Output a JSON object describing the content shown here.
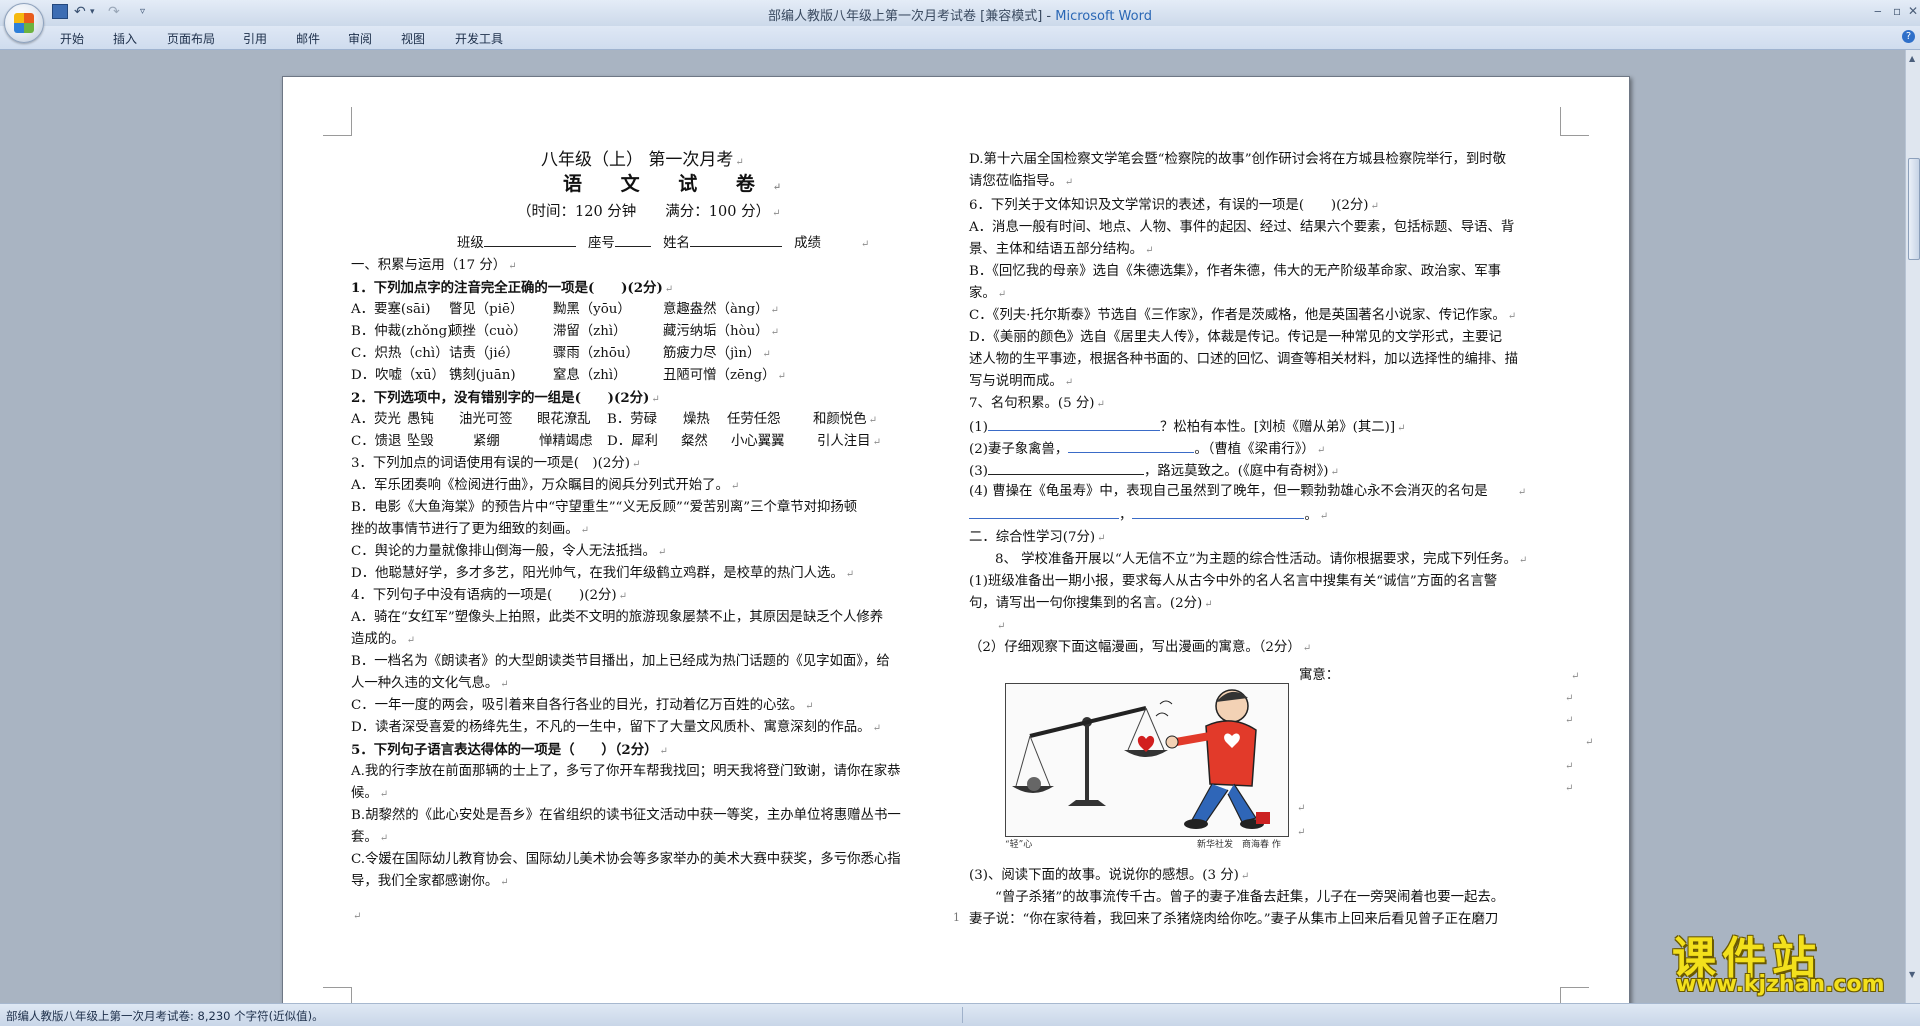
{
  "window": {
    "title": "部编人教版八年级上第一次月考试卷 [兼容模式] - ",
    "app_name": "Microsoft Word",
    "min_label": "‒",
    "max_label": "▫",
    "close_label": "✕"
  },
  "quick_access": {
    "undo_label": "↶",
    "redo_label": "↷",
    "drop_label": "▾",
    "custom_label": "▿"
  },
  "tabs": [
    "开始",
    "插入",
    "页面布局",
    "引用",
    "邮件",
    "审阅",
    "视图",
    "开发工具"
  ],
  "help_label": "?",
  "status_bar": {
    "text": "部编人教版八年级上第一次月考试卷: 8,230 个字符(近似值)。"
  },
  "page_number": "1",
  "left_column": {
    "title1": "八年级（上） 第一次月考",
    "title2": "语 文 试 卷",
    "time_line": "（时间：120 分钟　　满分：100 分）",
    "info_class": "班级",
    "info_seat": "座号",
    "info_name": "姓名",
    "info_score": "成绩",
    "sec1": "一、积累与运用（17 分）",
    "q1": "1．下列加点字的注音完全正确的一项是(　　)(2分)",
    "q1a": [
      "A．要塞(sāi)",
      "瞥见（piē）",
      "黝黑（yōu）",
      "意趣盎然（àng）"
    ],
    "q1b": [
      "B．仲裁(zhǒng)",
      "顿挫（cuò）",
      "滞留（zhì）",
      "藏污纳垢（hòu）"
    ],
    "q1c": [
      "C．炽热（chì）",
      "诘责（jié）",
      "骤雨（zhōu）",
      "筋疲力尽（jìn）"
    ],
    "q1d": [
      "D．吹嘘（xū）",
      "镌刻(juān)",
      "窒息（zhì）",
      "丑陋可憎（zēng）"
    ],
    "q2": "2．下列选项中，没有错别字的一组是(　　)(2分)",
    "q2ab": [
      "A．荧光",
      "愚钝",
      "油光可签",
      "眼花潦乱",
      "B．劳碌",
      "燥热",
      "任劳任怨",
      "和颜悦色"
    ],
    "q2cd": [
      "C．馈退",
      "坠毁",
      "紧绷",
      "惮精竭虑",
      "D．犀利",
      "粲然",
      "小心翼翼",
      "引人注目"
    ],
    "q3": "3．下列加点的词语使用有误的一项是(　)(2分)",
    "q3a": "A．军乐团奏响《检阅进行曲》，万众瞩目的阅兵分列式开始了。",
    "q3b1": "B．电影《大鱼海棠》的预告片中“守望重生”“义无反顾”“爱苦别离”三个章节对抑扬顿",
    "q3b2": "挫的故事情节进行了更为细致的刻画。",
    "q3c": "C．舆论的力量就像排山倒海一般，令人无法抵挡。",
    "q3d": "D．他聪慧好学，多才多艺，阳光帅气，在我们年级鹤立鸡群，是校草的热门人选。",
    "q4": "4．下列句子中没有语病的一项是(　　)(2分)",
    "q4a1": "A．骑在“女红军”塑像头上拍照，此类不文明的旅游现象屡禁不止，其原因是缺乏个人修养",
    "q4a2": "造成的。",
    "q4b1": "B．一档名为《朗读者》的大型朗读类节目播出，加上已经成为热门话题的《见字如面》，给",
    "q4b2": "人一种久违的文化气息。",
    "q4c": "C．一年一度的两会，吸引着来自各行各业的目光，打动着亿万百姓的心弦。",
    "q4d": "D．读者深受喜爱的杨绛先生，不凡的一生中，留下了大量文风质朴、寓意深刻的作品。",
    "q5": "5．下列句子语言表达得体的一项是（　　）（2分）",
    "q5a1": "A.我的行李放在前面那辆的士上了，多亏了你开车帮我找回；明天我将登门致谢，请你在家恭",
    "q5a2": "候。",
    "q5b1": "B.胡黎然的《此心安处是吾乡》在省组织的读书征文活动中获一等奖，主办单位将惠赠丛书一",
    "q5b2": "套。",
    "q5c1": "C.令媛在国际幼儿教育协会、国际幼儿美术协会等多家举办的美术大赛中获奖，多亏你悉心指",
    "q5c2": "导，我们全家都感谢你。"
  },
  "right_column": {
    "d1": "D.第十六届全国检察文学笔会暨“检察院的故事”创作研讨会将在方城县检察院举行，到时敬",
    "d2": "请您莅临指导。",
    "q6": "6．下列关于文体知识及文学常识的表述，有误的一项是(　　)(2分)",
    "q6a1": "A．消息一般有时间、地点、人物、事件的起因、经过、结果六个要素，包括标题、导语、背",
    "q6a2": "景、主体和结语五部分结构。",
    "q6b1": "B．《回忆我的母亲》选自《朱德选集》，作者朱德，伟大的无产阶级革命家、政治家、军事",
    "q6b2": "家。",
    "q6c": "C．《列夫·托尔斯泰》节选自《三作家》，作者是茨威格，他是英国著名小说家、传记作家。",
    "q6d1": "D．《美丽的颜色》选自《居里夫人传》，体裁是传记。传记是一种常见的文学形式，主要记",
    "q6d2": "述人物的生平事迹，根据各种书面的、口述的回忆、调查等相关材料，加以选择性的编排、描",
    "q6d3": "写与说明而成。",
    "q7": "7、名句积累。(5 分)",
    "q7_1_pre": "(1)",
    "q7_1_post": "？松柏有本性。[刘桢《赠从弟》(其二)]",
    "q7_2_pre": "(2)妻子象禽兽，",
    "q7_2_post": "。（曹植《梁甫行》）",
    "q7_3_pre": "(3)",
    "q7_3_post": "，路远莫致之。(《庭中有奇树》)",
    "q7_4": "(4) 曹操在《龟虽寿》中，表现自己虽然到了晚年，但一颗勃勃雄心永不会消灭的名句是",
    "q7_4b": "，",
    "q7_4c": "。",
    "sec2": "二．综合性学习(7分)",
    "q8": "8、 学校准备开展以“人无信不立”为主题的综合性活动。请你根据要求，完成下列任务。",
    "q8_1a": "(1)班级准备出一期小报，要求每人从古今中外的名人名言中搜集有关“诚信”方面的名言警",
    "q8_1b": "句，请写出一句你搜集到的名言。(2分)",
    "q8_2": "（2）仔细观察下面这幅漫画，写出漫画的寓意。（2分）",
    "q8_2_label": "寓意：",
    "cartoon_caption_left": "“轻”心",
    "cartoon_caption_right": "新华社发　商海春 作",
    "q8_3": "(3)、阅读下面的故事。说说你的感想。(3 分)",
    "story1": "“曾子杀猪”的故事流传千古。曾子的妻子准备去赶集，儿子在一旁哭闹着也要一起去。",
    "story2": "妻子说：“你在家待着，我回来了杀猪烧肉给你吃。”妻子从集市上回来后看见曾子正在磨刀"
  },
  "watermark": {
    "cn": "课件站",
    "url": "www.kjzhan.com"
  }
}
